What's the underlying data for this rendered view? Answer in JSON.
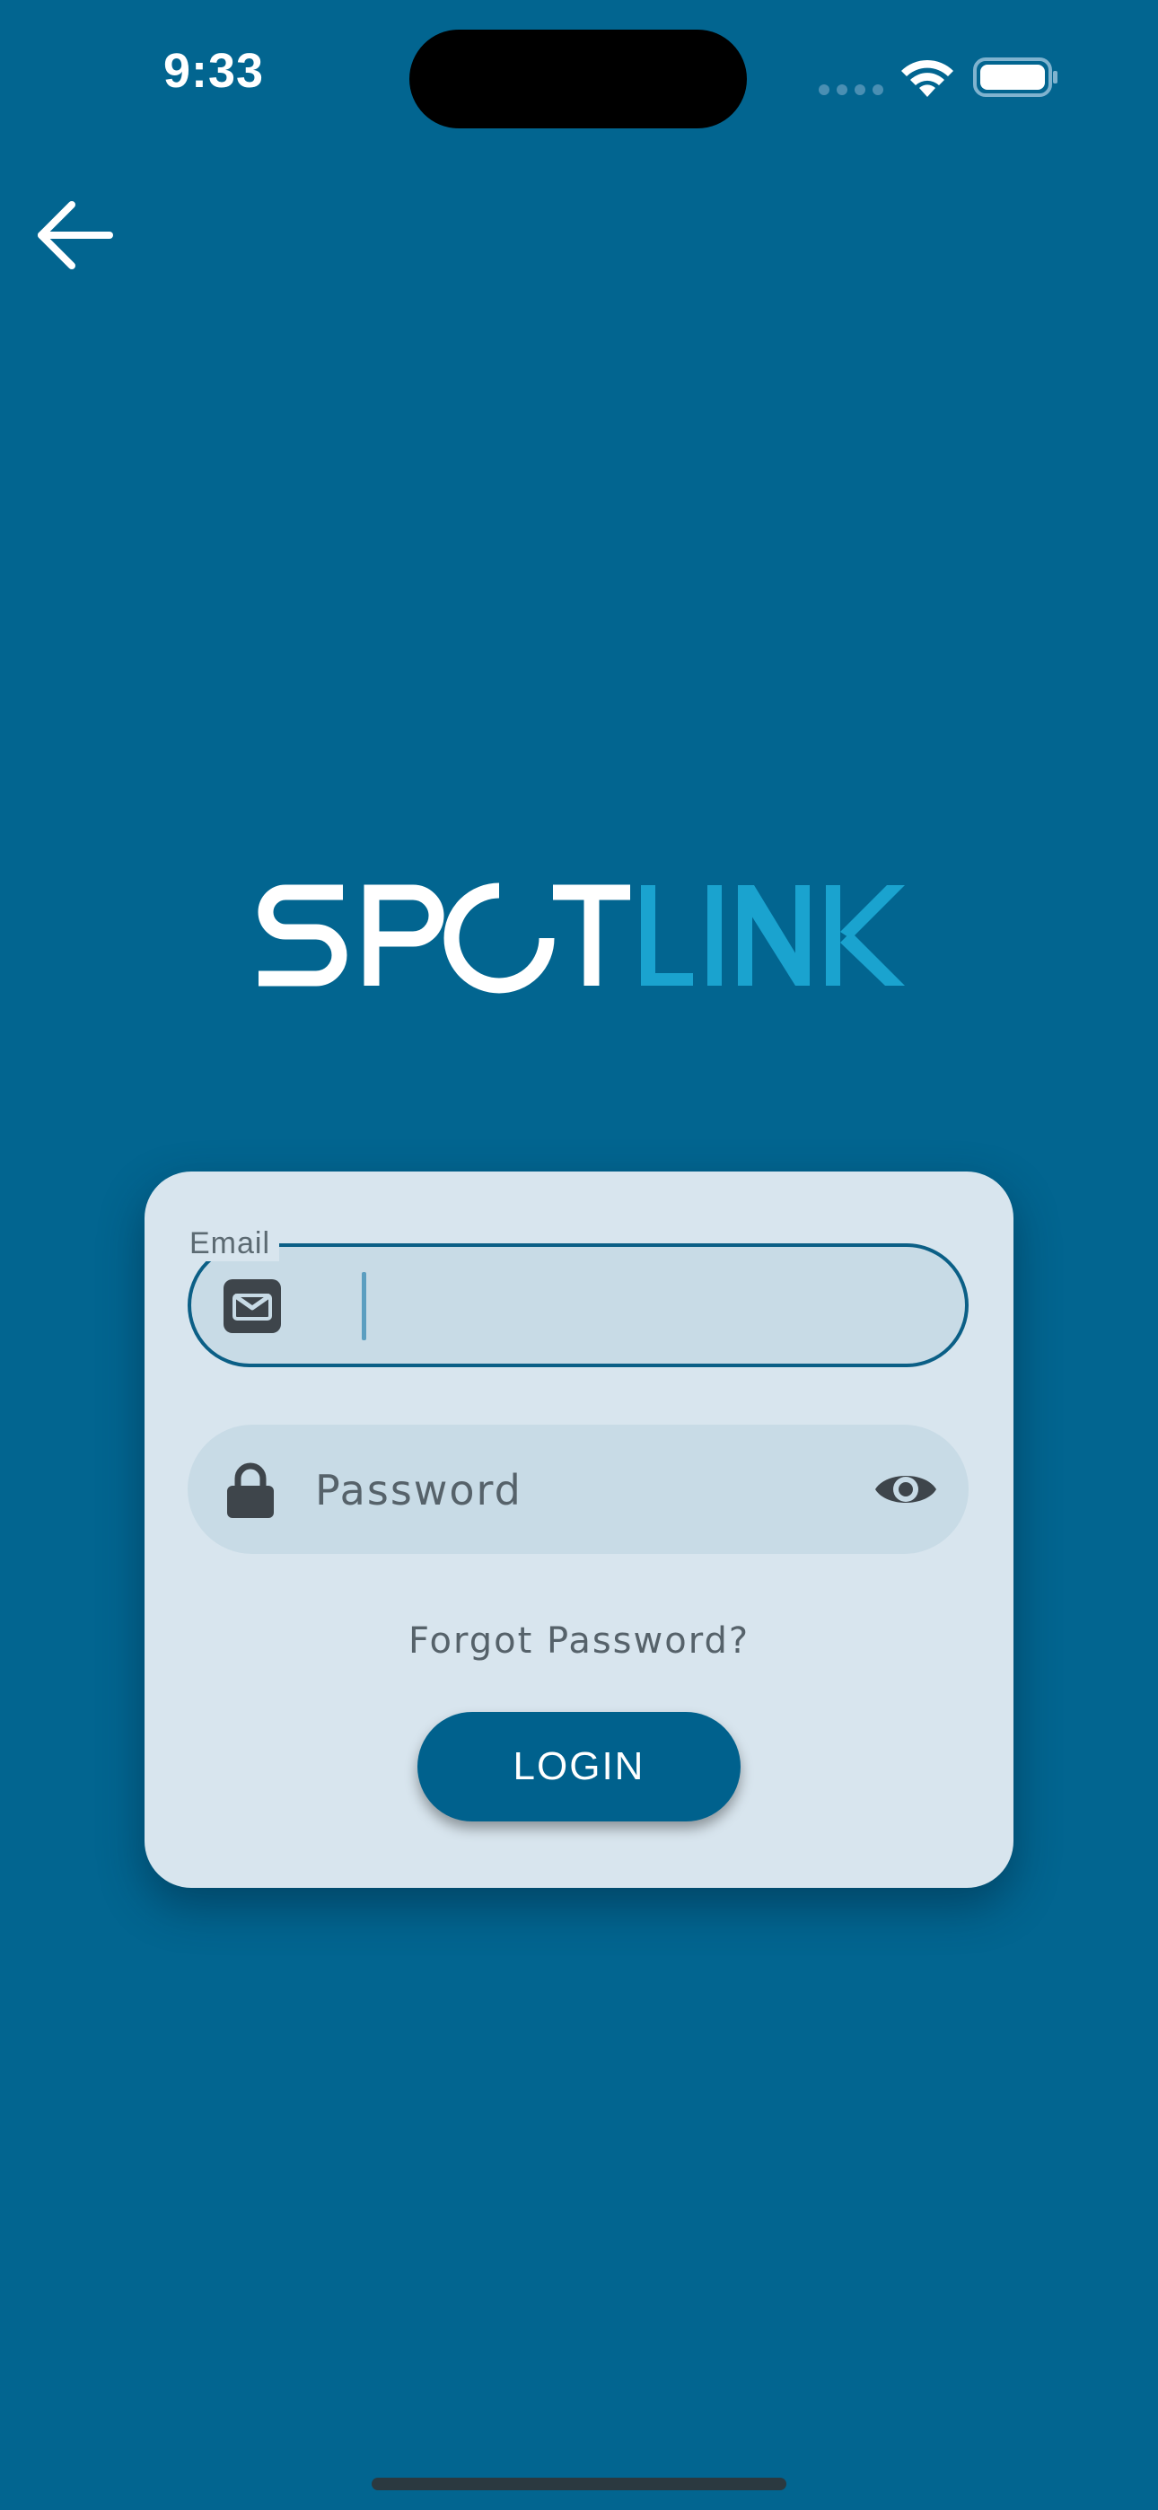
{
  "status_bar": {
    "time": "9:33"
  },
  "header": {
    "back_icon": "arrow-left-icon"
  },
  "logo": {
    "text_part1": "SPOT",
    "text_part2": "LINK",
    "color_part1": "#ffffff",
    "color_part2": "#1aa3cf"
  },
  "login_form": {
    "email": {
      "label": "Email",
      "value": "",
      "icon": "envelope-icon"
    },
    "password": {
      "placeholder": "Password",
      "value": "",
      "icon": "lock-icon",
      "toggle_icon": "eye-icon"
    },
    "forgot_password_label": "Forgot Password?",
    "login_button_label": "LOGIN"
  },
  "colors": {
    "background": "#026590",
    "card": "#d8e5ee",
    "field": "#c8dbe6",
    "accent": "#00618d"
  }
}
